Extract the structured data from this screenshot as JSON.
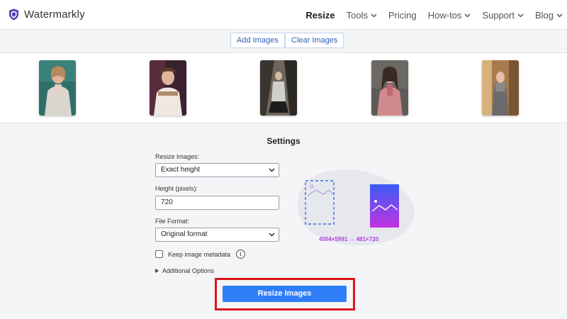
{
  "app": {
    "name": "Watermarkly"
  },
  "nav": [
    {
      "label": "Resize",
      "active": true,
      "dropdown": false
    },
    {
      "label": "Tools",
      "active": false,
      "dropdown": true
    },
    {
      "label": "Pricing",
      "active": false,
      "dropdown": false
    },
    {
      "label": "How-tos",
      "active": false,
      "dropdown": true
    },
    {
      "label": "Support",
      "active": false,
      "dropdown": true
    },
    {
      "label": "Blog",
      "active": false,
      "dropdown": true
    }
  ],
  "toolbar": {
    "add_label": "Add Images",
    "clear_label": "Clear Images"
  },
  "images": [
    {
      "name": "photo-1",
      "icon": "portrait-thumbnail"
    },
    {
      "name": "photo-2",
      "icon": "portrait-thumbnail"
    },
    {
      "name": "photo-3",
      "icon": "portrait-thumbnail"
    },
    {
      "name": "photo-4",
      "icon": "portrait-thumbnail"
    },
    {
      "name": "photo-5",
      "icon": "portrait-thumbnail"
    }
  ],
  "settings": {
    "title": "Settings",
    "resize_label": "Resize Images:",
    "resize_value": "Exact height",
    "height_label": "Height (pixels):",
    "height_value": "720",
    "format_label": "File Format:",
    "format_value": "Original format",
    "metadata_label": "Keep image metadata",
    "metadata_checked": false,
    "info_glyph": "i",
    "additional_label": "Additional Options"
  },
  "illustration": {
    "dimensions": "4004×5991 → 481×720"
  },
  "action": {
    "resize_label": "Resize Images"
  },
  "colors": {
    "accent": "#2d7ef7",
    "link": "#2e5fb8",
    "highlight": "#d9181e",
    "dims": "#b040d8",
    "logo": "#4b3fb5"
  }
}
